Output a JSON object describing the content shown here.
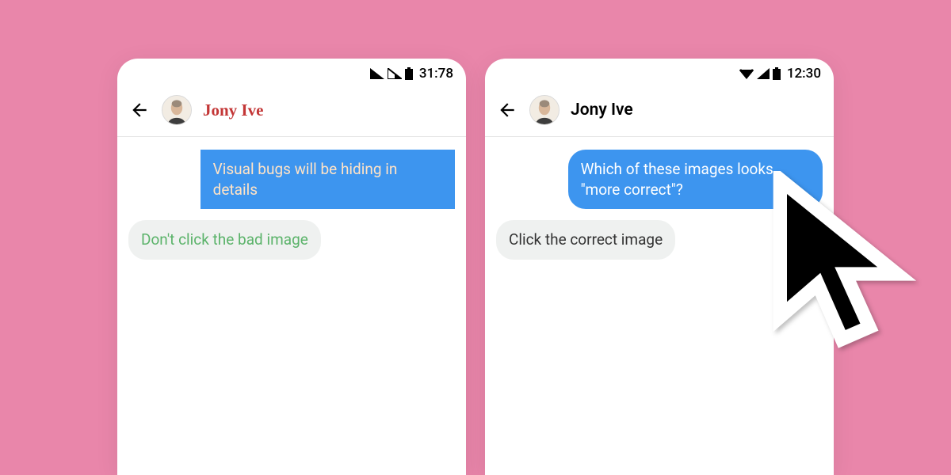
{
  "background_color": "#e986aa",
  "phones": {
    "left": {
      "status": {
        "time": "31:78",
        "icons": [
          "signal-skew-icon",
          "signal-skew2-icon",
          "battery-icon"
        ]
      },
      "header": {
        "contact": "Jony Ive"
      },
      "messages": {
        "outgoing": "Visual bugs will be hiding in details",
        "incoming": "Don't click the bad image"
      }
    },
    "right": {
      "status": {
        "time": "12:30",
        "icons": [
          "wifi-icon",
          "cell-icon",
          "battery-icon"
        ]
      },
      "header": {
        "contact": "Jony Ive"
      },
      "messages": {
        "outgoing": "Which of these images looks \"more correct\"?",
        "incoming": "Click the correct image"
      }
    }
  },
  "colors": {
    "bubble_out": "#3d95ef",
    "bubble_in": "#eff1f0",
    "bad_name": "#c33636",
    "bad_in_text": "#5bb36a"
  }
}
